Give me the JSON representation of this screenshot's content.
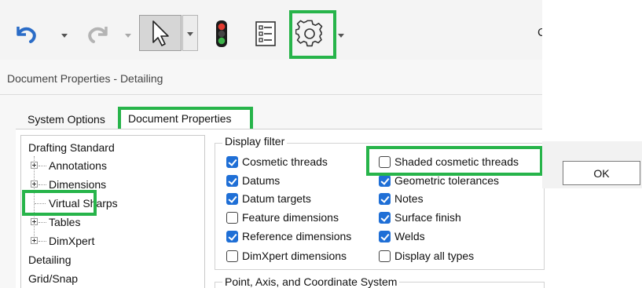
{
  "toolbar": {
    "undo_icon": "undo-icon",
    "redo_icon": "redo-icon",
    "select_icon": "select-pointer-icon",
    "traffic_light_icon": "rebuild-traffic-light-icon",
    "list_icon": "file-properties-list-icon",
    "gear_icon": "options-gear-icon",
    "cut_off_text": "C",
    "highlight_color": "#27b44a"
  },
  "dialog": {
    "title": "Document Properties - Detailing",
    "tabs": [
      {
        "label": "System Options"
      },
      {
        "label": "Document Properties"
      }
    ],
    "tree": [
      {
        "label": "Drafting Standard"
      },
      {
        "label": "Annotations"
      },
      {
        "label": "Dimensions"
      },
      {
        "label": "Virtual Sharps"
      },
      {
        "label": "Tables"
      },
      {
        "label": "DimXpert"
      },
      {
        "label": "Detailing"
      },
      {
        "label": "Grid/Snap"
      }
    ],
    "display_filter": {
      "label": "Display filter",
      "options": [
        {
          "label": "Cosmetic threads",
          "checked": true
        },
        {
          "label": "Datums",
          "checked": true
        },
        {
          "label": "Datum targets",
          "checked": true
        },
        {
          "label": "Feature dimensions",
          "checked": false
        },
        {
          "label": "Reference dimensions",
          "checked": true
        },
        {
          "label": "DimXpert dimensions",
          "checked": false
        },
        {
          "label": "Shaded cosmetic threads",
          "checked": false
        },
        {
          "label": "Geometric tolerances",
          "checked": true
        },
        {
          "label": "Notes",
          "checked": true
        },
        {
          "label": "Surface finish",
          "checked": true
        },
        {
          "label": "Welds",
          "checked": true
        },
        {
          "label": "Display all types",
          "checked": false
        }
      ]
    },
    "next_group_label": "Point, Axis, and Coordinate System",
    "ok_label": "OK"
  }
}
